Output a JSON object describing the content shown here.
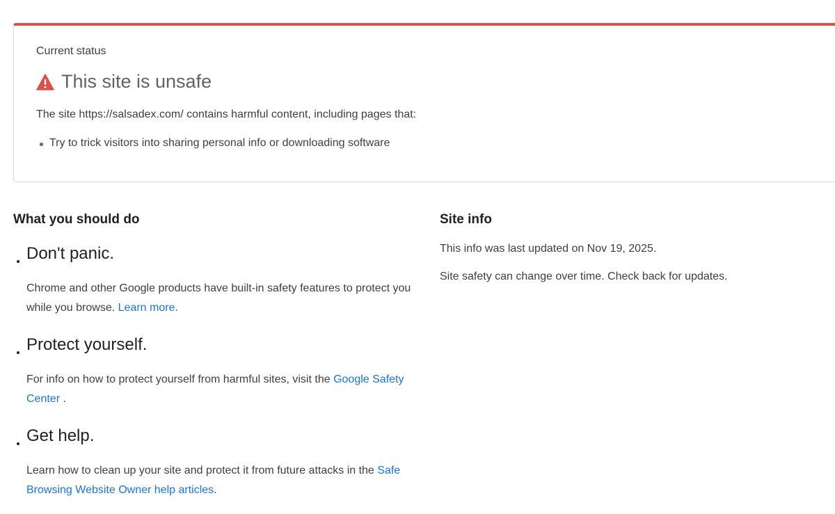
{
  "status": {
    "label": "Current status",
    "title": "This site is unsafe",
    "description": "The site https://salsadex.com/ contains harmful content, including pages that:",
    "items": [
      "Try to trick visitors into sharing personal info or downloading software"
    ],
    "accent_color": "#d9534a"
  },
  "advice": {
    "heading": "What you should do",
    "items": [
      {
        "title": "Don't panic.",
        "text_before": "Chrome and other Google products have built-in safety features to protect you while you browse.",
        "link": "Learn more.",
        "text_after": ""
      },
      {
        "title": "Protect yourself.",
        "text_before": "For info on how to protect yourself from harmful sites, visit the",
        "link": "Google Safety Center",
        "text_after": "."
      },
      {
        "title": "Get help.",
        "text_before": "Learn how to clean up your site and protect it from future attacks in the",
        "link": "Safe Browsing Website Owner help articles",
        "text_after": "."
      }
    ]
  },
  "site_info": {
    "heading": "Site info",
    "updated": "This info was last updated on Nov 19, 2025.",
    "note": "Site safety can change over time. Check back for updates."
  },
  "icons": {
    "warning": "warning-triangle-icon"
  },
  "colors": {
    "link": "#1a73e8",
    "warning": "#d9534a"
  }
}
